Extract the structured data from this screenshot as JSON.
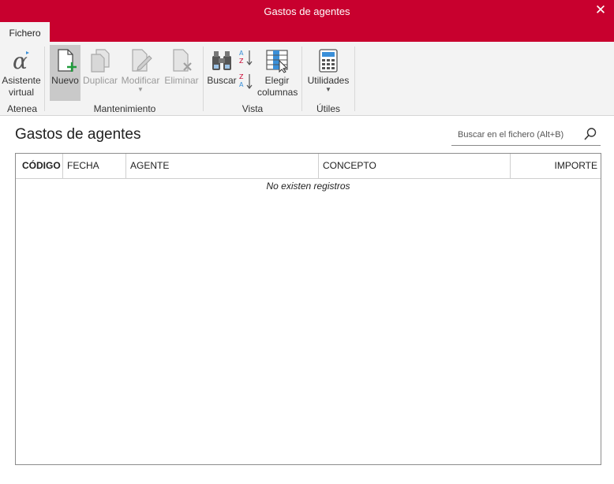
{
  "window": {
    "title": "Gastos de agentes",
    "close_glyph": "✕"
  },
  "tabs": [
    {
      "label": "Fichero"
    }
  ],
  "ribbon": {
    "groups": [
      {
        "label": "Atenea",
        "buttons": [
          {
            "label": "Asistente virtual",
            "icon": "alpha-icon",
            "enabled": true
          }
        ]
      },
      {
        "label": "Mantenimiento",
        "buttons": [
          {
            "label": "Nuevo",
            "icon": "new-document-icon",
            "enabled": true,
            "active": true
          },
          {
            "label": "Duplicar",
            "icon": "duplicate-icon",
            "enabled": false
          },
          {
            "label": "Modificar",
            "icon": "edit-document-icon",
            "enabled": false,
            "dropdown": true
          },
          {
            "label": "Eliminar",
            "icon": "delete-document-icon",
            "enabled": false
          }
        ]
      },
      {
        "label": "Vista",
        "buttons": [
          {
            "label": "Buscar",
            "icon": "binoculars-icon",
            "enabled": true
          },
          {
            "label": "Ordenar ascendente",
            "icon": "sort-az-icon",
            "enabled": true
          },
          {
            "label": "Ordenar descendente",
            "icon": "sort-za-icon",
            "enabled": true
          },
          {
            "label": "Elegir columnas",
            "icon": "choose-columns-icon",
            "enabled": true
          }
        ]
      },
      {
        "label": "Útiles",
        "buttons": [
          {
            "label": "Utilidades",
            "icon": "calculator-icon",
            "enabled": true,
            "dropdown": true
          }
        ]
      }
    ]
  },
  "main": {
    "title": "Gastos de agentes",
    "search": {
      "placeholder": "Buscar en el fichero (Alt+B)"
    },
    "table": {
      "columns": [
        "CÓDIGO",
        "FECHA",
        "AGENTE",
        "CONCEPTO",
        "IMPORTE"
      ],
      "empty_message": "No existen registros"
    }
  },
  "colors": {
    "accent": "#c8002e",
    "ribbon_bg": "#f3f3f3",
    "active_button": "#c9c9c9"
  }
}
